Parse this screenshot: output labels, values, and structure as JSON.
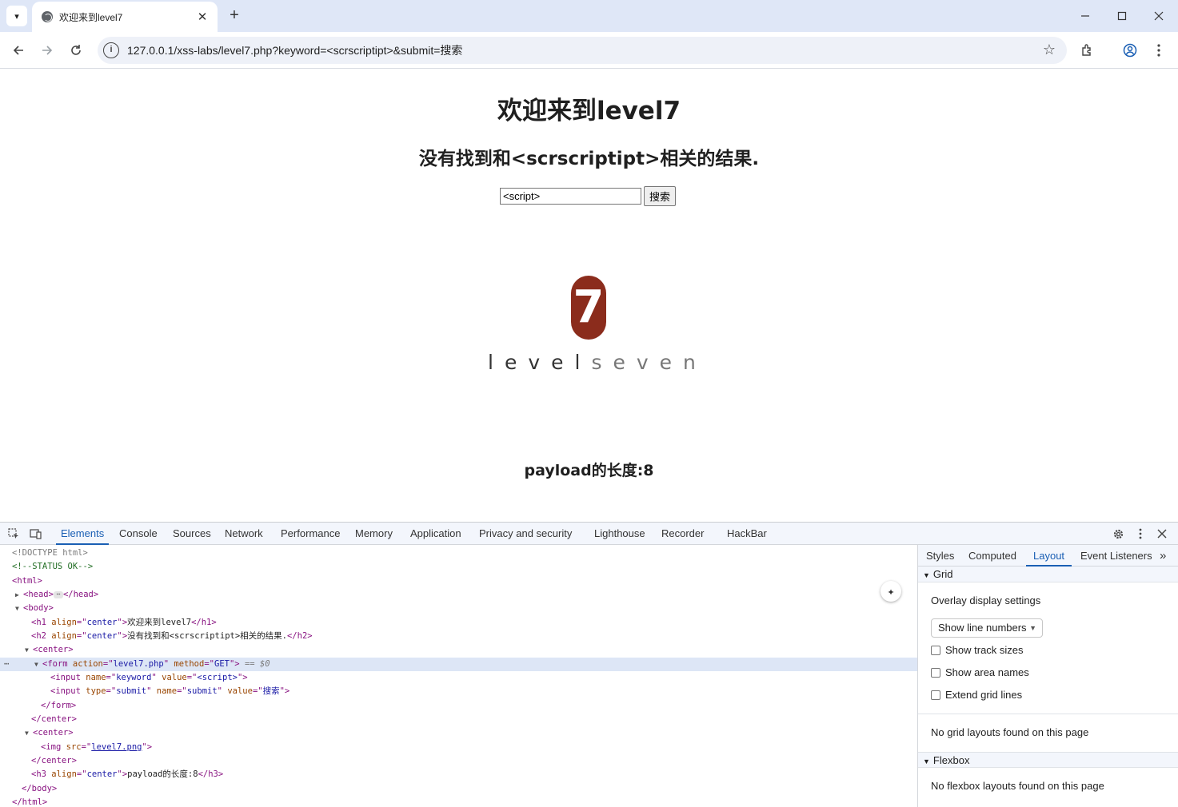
{
  "browser": {
    "tab_title": "欢迎来到level7",
    "tab_close": "✕",
    "new_tab": "+",
    "url": "127.0.0.1/xss-labs/level7.php?keyword=<scrscriptipt>&submit=搜索"
  },
  "page": {
    "h1": "欢迎来到level7",
    "h2": "没有找到和<scrscriptipt>相关的结果.",
    "keyword_value": "<script>",
    "submit_label": "搜索",
    "logo": {
      "digit": "7",
      "word_dark": "level",
      "word_light": "seven"
    },
    "h3": "payload的长度:8"
  },
  "devtools": {
    "tabs": [
      "Elements",
      "Console",
      "Sources",
      "Network",
      "Performance",
      "Memory",
      "Application",
      "Privacy and security",
      "Lighthouse",
      "Recorder",
      "HackBar"
    ],
    "active_tab": "Elements",
    "code": {
      "doctype": "<!DOCTYPE html>",
      "comment": "<!--STATUS OK-->",
      "html_open": "<html>",
      "head_open": "<head>",
      "head_ellipsis": "⋯",
      "head_close": "</head>",
      "body_open": "<body>",
      "h1_tag": "<h1",
      "h1_attr": " align",
      "h1_eq": "=\"",
      "h1_val": "center",
      "h1_end": "\">",
      "h1_text": "欢迎来到level7",
      "h1_close": "</h1>",
      "h2_tag": "<h2",
      "h2_attr": " align",
      "h2_val": "center",
      "h2_text": "没有找到和<scrscriptipt>相关的结果.",
      "h2_close": "</h2>",
      "center_open": "<center>",
      "form_tag": "<form",
      "form_attr1": " action",
      "form_val1": "level7.php",
      "form_attr2": " method",
      "form_val2": "GET",
      "form_end": "\">",
      "form_dollar": " == $0",
      "input1_tag": "<input",
      "input1_attr1": " name",
      "input1_val1": "keyword",
      "input1_attr2": " value",
      "input1_val2": "<script>",
      "input2_tag": "<input",
      "input2_attr1": " type",
      "input2_val1": "submit",
      "input2_attr2": " name",
      "input2_val2": "submit",
      "input2_attr3": " value",
      "input2_val3": "搜索",
      "form_close": "</form>",
      "center_close": "</center>",
      "img_tag": "<img",
      "img_attr": " src",
      "img_val": "level7.png",
      "h3_tag": "<h3",
      "h3_attr": " align",
      "h3_val": "center",
      "h3_text": "payload的长度:8",
      "h3_close": "</h3>",
      "body_close": "</body>",
      "html_close": "</html>",
      "dots": "⋯"
    },
    "sidebar": {
      "tabs": [
        "Styles",
        "Computed",
        "Layout",
        "Event Listeners"
      ],
      "more": "»",
      "active_tab": "Layout",
      "grid_header": "Grid",
      "overlay_settings": "Overlay display settings",
      "select_value": "Show line numbers",
      "checkboxes": [
        "Show track sizes",
        "Show area names",
        "Extend grid lines"
      ],
      "no_grid": "No grid layouts found on this page",
      "flexbox_header": "Flexbox",
      "no_flex": "No flexbox layouts found on this page"
    }
  },
  "colors": {
    "accent": "#1a5fb4",
    "logo_red": "#8b2c1c"
  }
}
